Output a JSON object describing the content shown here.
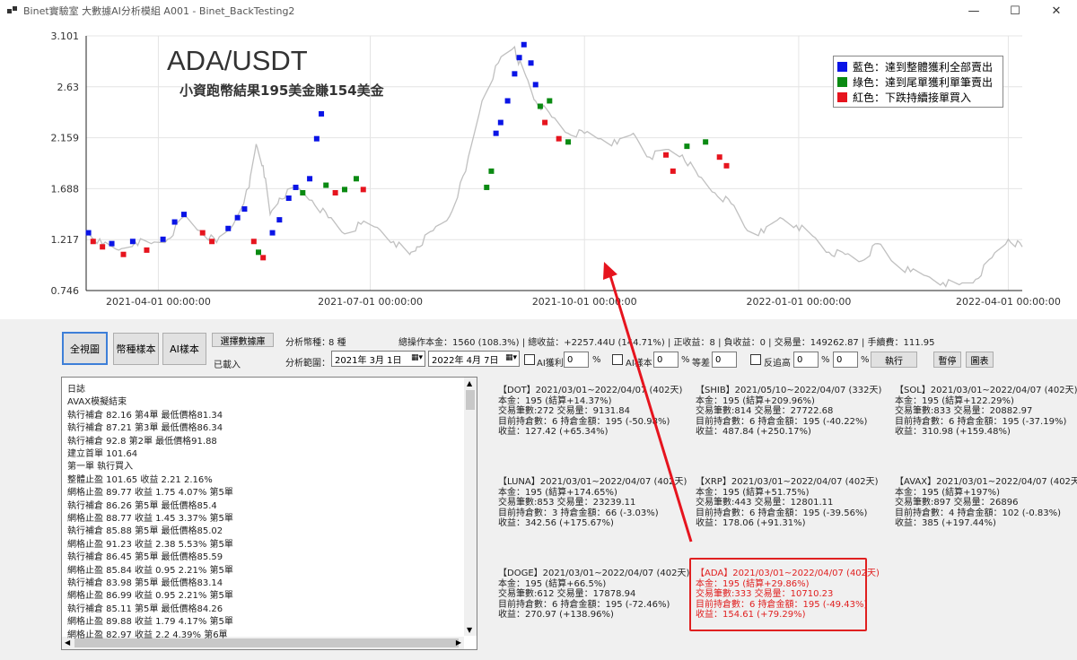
{
  "window": {
    "title": "Binet實驗室  大數據AI分析模組 A001 - Binet_BackTesting2",
    "minimize": "—",
    "maximize": "☐",
    "close": "✕"
  },
  "chart": {
    "title": "ADA/USDT",
    "subtitle": "小資跑幣結果195美金賺154美金",
    "legend": [
      {
        "label": "藍色：達到整體獲利全部賣出",
        "color": "#0a14e6"
      },
      {
        "label": "綠色：達到尾單獲利單筆賣出",
        "color": "#0a8a12"
      },
      {
        "label": "紅色：下跌持續接單買入",
        "color": "#e6141e"
      }
    ]
  },
  "chart_data": {
    "type": "line",
    "y_ticks": [
      "3.101",
      "2.63",
      "2.159",
      "1.688",
      "1.217",
      "0.746"
    ],
    "x_ticks": [
      "2021-04-01 00:00:00",
      "2021-07-01 00:00:00",
      "2021-10-01 00:00:00",
      "2022-01-01 00:00:00",
      "2022-04-01 00:00:00"
    ],
    "ylim": [
      0.746,
      3.101
    ],
    "xlim": [
      "2021-03-01",
      "2022-04-07"
    ],
    "grid": true,
    "legend_position": "top-right",
    "series": [
      {
        "color": "#c0c0c0",
        "x": [
          "2021-03-01",
          "2021-03-08",
          "2021-03-15",
          "2021-03-22",
          "2021-03-29",
          "2021-04-05",
          "2021-04-12",
          "2021-04-19",
          "2021-04-26",
          "2021-05-03",
          "2021-05-10",
          "2021-05-13",
          "2021-05-16",
          "2021-05-19",
          "2021-05-23",
          "2021-05-30",
          "2021-06-06",
          "2021-06-13",
          "2021-06-20",
          "2021-06-27",
          "2021-07-04",
          "2021-07-11",
          "2021-07-18",
          "2021-07-21",
          "2021-07-28",
          "2021-08-04",
          "2021-08-11",
          "2021-08-18",
          "2021-08-25",
          "2021-09-01",
          "2021-09-02",
          "2021-09-06",
          "2021-09-10",
          "2021-09-17",
          "2021-09-24",
          "2021-10-01",
          "2021-10-08",
          "2021-10-15",
          "2021-10-22",
          "2021-10-29",
          "2021-11-05",
          "2021-11-12",
          "2021-11-19",
          "2021-11-26",
          "2021-12-03",
          "2021-12-10",
          "2021-12-17",
          "2021-12-24",
          "2021-12-31",
          "2022-01-07",
          "2022-01-14",
          "2022-01-21",
          "2022-01-28",
          "2022-02-04",
          "2022-02-11",
          "2022-02-18",
          "2022-02-25",
          "2022-03-04",
          "2022-03-11",
          "2022-03-18",
          "2022-03-25",
          "2022-04-01",
          "2022-04-07"
        ],
        "y": [
          1.3,
          1.17,
          1.12,
          1.2,
          1.18,
          1.22,
          1.43,
          1.3,
          1.19,
          1.35,
          1.7,
          2.1,
          1.9,
          1.45,
          1.6,
          1.7,
          1.58,
          1.42,
          1.27,
          1.36,
          1.33,
          1.2,
          1.08,
          1.15,
          1.3,
          1.43,
          1.85,
          2.5,
          2.85,
          3.0,
          2.9,
          2.72,
          2.5,
          2.35,
          2.2,
          2.2,
          2.15,
          2.1,
          2.2,
          1.98,
          2.05,
          2.0,
          1.8,
          1.65,
          1.55,
          1.3,
          1.28,
          1.42,
          1.35,
          1.25,
          1.1,
          1.08,
          1.02,
          1.18,
          1.0,
          0.92,
          0.88,
          0.82,
          0.8,
          0.85,
          1.05,
          1.22,
          1.15
        ]
      }
    ],
    "markers": [
      {
        "x": "2021-03-02",
        "y": 1.28,
        "kind": "blue"
      },
      {
        "x": "2021-03-04",
        "y": 1.2,
        "kind": "red"
      },
      {
        "x": "2021-03-08",
        "y": 1.15,
        "kind": "red"
      },
      {
        "x": "2021-03-12",
        "y": 1.18,
        "kind": "blue"
      },
      {
        "x": "2021-03-17",
        "y": 1.08,
        "kind": "red"
      },
      {
        "x": "2021-03-21",
        "y": 1.2,
        "kind": "blue"
      },
      {
        "x": "2021-03-27",
        "y": 1.12,
        "kind": "red"
      },
      {
        "x": "2021-04-03",
        "y": 1.22,
        "kind": "blue"
      },
      {
        "x": "2021-04-08",
        "y": 1.38,
        "kind": "blue"
      },
      {
        "x": "2021-04-12",
        "y": 1.45,
        "kind": "blue"
      },
      {
        "x": "2021-04-20",
        "y": 1.28,
        "kind": "red"
      },
      {
        "x": "2021-04-24",
        "y": 1.2,
        "kind": "red"
      },
      {
        "x": "2021-05-01",
        "y": 1.32,
        "kind": "blue"
      },
      {
        "x": "2021-05-05",
        "y": 1.42,
        "kind": "blue"
      },
      {
        "x": "2021-05-08",
        "y": 1.5,
        "kind": "blue"
      },
      {
        "x": "2021-05-12",
        "y": 1.2,
        "kind": "red"
      },
      {
        "x": "2021-05-14",
        "y": 1.1,
        "kind": "green"
      },
      {
        "x": "2021-05-16",
        "y": 1.05,
        "kind": "red"
      },
      {
        "x": "2021-05-20",
        "y": 1.28,
        "kind": "blue"
      },
      {
        "x": "2021-05-23",
        "y": 1.4,
        "kind": "blue"
      },
      {
        "x": "2021-05-27",
        "y": 1.6,
        "kind": "blue"
      },
      {
        "x": "2021-05-30",
        "y": 1.7,
        "kind": "blue"
      },
      {
        "x": "2021-06-02",
        "y": 1.65,
        "kind": "green"
      },
      {
        "x": "2021-06-05",
        "y": 1.78,
        "kind": "blue"
      },
      {
        "x": "2021-06-08",
        "y": 2.15,
        "kind": "blue"
      },
      {
        "x": "2021-06-10",
        "y": 2.38,
        "kind": "blue"
      },
      {
        "x": "2021-06-12",
        "y": 1.72,
        "kind": "green"
      },
      {
        "x": "2021-06-16",
        "y": 1.65,
        "kind": "red"
      },
      {
        "x": "2021-06-20",
        "y": 1.68,
        "kind": "green"
      },
      {
        "x": "2021-06-25",
        "y": 1.78,
        "kind": "green"
      },
      {
        "x": "2021-06-28",
        "y": 1.68,
        "kind": "red"
      },
      {
        "x": "2021-08-20",
        "y": 1.7,
        "kind": "green"
      },
      {
        "x": "2021-08-22",
        "y": 1.85,
        "kind": "green"
      },
      {
        "x": "2021-08-24",
        "y": 2.2,
        "kind": "blue"
      },
      {
        "x": "2021-08-26",
        "y": 2.3,
        "kind": "blue"
      },
      {
        "x": "2021-08-29",
        "y": 2.5,
        "kind": "blue"
      },
      {
        "x": "2021-09-01",
        "y": 2.75,
        "kind": "blue"
      },
      {
        "x": "2021-09-03",
        "y": 2.9,
        "kind": "blue"
      },
      {
        "x": "2021-09-05",
        "y": 3.02,
        "kind": "blue"
      },
      {
        "x": "2021-09-08",
        "y": 2.85,
        "kind": "blue"
      },
      {
        "x": "2021-09-10",
        "y": 2.65,
        "kind": "blue"
      },
      {
        "x": "2021-09-12",
        "y": 2.45,
        "kind": "green"
      },
      {
        "x": "2021-09-14",
        "y": 2.3,
        "kind": "red"
      },
      {
        "x": "2021-09-16",
        "y": 2.5,
        "kind": "green"
      },
      {
        "x": "2021-09-20",
        "y": 2.15,
        "kind": "red"
      },
      {
        "x": "2021-09-24",
        "y": 2.12,
        "kind": "green"
      },
      {
        "x": "2021-11-05",
        "y": 2.0,
        "kind": "red"
      },
      {
        "x": "2021-11-08",
        "y": 1.85,
        "kind": "red"
      },
      {
        "x": "2021-11-14",
        "y": 2.08,
        "kind": "green"
      },
      {
        "x": "2021-11-22",
        "y": 2.12,
        "kind": "green"
      },
      {
        "x": "2021-11-28",
        "y": 1.98,
        "kind": "red"
      },
      {
        "x": "2021-12-01",
        "y": 1.9,
        "kind": "red"
      }
    ]
  },
  "controls": {
    "btn_fullview": "全視圖",
    "btn_coinsample": "幣種樣本",
    "btn_aisample": "AI樣本",
    "btn_selectdata": "選擇數據庫",
    "loaded": "已載入",
    "analysis_coins_label": "分析幣種：",
    "analysis_coins_value": "8 種",
    "analysis_range_label": "分析範圍：",
    "date_start": "2021年  3月  1日",
    "date_end": "2022年  4月  7日",
    "chk_ai_profit": "AI獲利",
    "chk_ai_sample": "AI樣本",
    "pct": "%",
    "diff_label": "等差",
    "chk_reverse": "反追高",
    "ai_profit_value": "0",
    "ai_sample_value": "0",
    "diff_value": "0",
    "rev_value1": "0",
    "rev_value2": "0",
    "btn_execute": "執行",
    "btn_pause": "暫停",
    "btn_chart": "圖表",
    "summary": "總操作本金：1560 (108.3%) | 總收益：+2257.44U (144.71%) | 正收益：8 | 負收益：0 | 交易量：149262.87 | 手續費：111.95"
  },
  "log": {
    "lines": [
      "日誌",
      "AVAX模擬結束",
      "執行補倉 82.16 第4單 最低價格81.34",
      "執行補倉 87.21 第3單 最低價格86.34",
      "執行補倉 92.8 第2單 最低價格91.88",
      "建立首單 101.64",
      "第一單 執行買入",
      "整體止盈 101.65 收益 2.21  2.16%",
      "網格止盈 89.77 收益 1.75 4.07% 第5單",
      "執行補倉 86.26 第5單 最低價格85.4",
      "網格止盈 88.77 收益 1.45 3.37% 第5單",
      "執行補倉 85.88 第5單 最低價格85.02",
      "網格止盈 91.23 收益 2.38 5.53% 第5單",
      "執行補倉 86.45 第5單 最低價格85.59",
      "網格止盈 85.84 收益 0.95 2.21% 第5單",
      "執行補倉 83.98 第5單 最低價格83.14",
      "網格止盈 86.99 收益 0.95 2.21% 第5單",
      "執行補倉 85.11 第5單 最低價格84.26",
      "網格止盈 89.88 收益 1.79 4.17% 第5單",
      "網格止盈 82.97 收益 2.2 4.39% 第6單"
    ]
  },
  "coins": [
    {
      "l1": "【DOT】2021/03/01~2022/04/07 (402天)",
      "l2": "本金：195  (結算+14.37%)",
      "l3": "交易筆數:272   交易量：9131.84",
      "l4": "目前持倉數：6  持倉金額：195 (-50.98%)",
      "l5": "收益：127.42 (+65.34%)"
    },
    {
      "l1": "【SHIB】2021/05/10~2022/04/07 (332天)",
      "l2": "本金：195  (結算+209.96%)",
      "l3": "交易筆數:814   交易量：27722.68",
      "l4": "目前持倉數：6  持倉金額：195 (-40.22%)",
      "l5": "收益：487.84 (+250.17%)"
    },
    {
      "l1": "【SOL】2021/03/01~2022/04/07 (402天)",
      "l2": "本金：195  (結算+122.29%)",
      "l3": "交易筆數:833   交易量：20882.97",
      "l4": "目前持倉數：6  持倉金額：195 (-37.19%)",
      "l5": "收益：310.98 (+159.48%)"
    },
    {
      "l1": "【LUNA】2021/03/01~2022/04/07 (402天)",
      "l2": "本金：195  (結算+174.65%)",
      "l3": "交易筆數:853   交易量：23239.11",
      "l4": "目前持倉數：3  持倉金額：66 (-3.03%)",
      "l5": "收益：342.56 (+175.67%)"
    },
    {
      "l1": "【XRP】2021/03/01~2022/04/07 (402天)",
      "l2": "本金：195  (結算+51.75%)",
      "l3": "交易筆數:443   交易量：12801.11",
      "l4": "目前持倉數：6  持倉金額：195 (-39.56%)",
      "l5": "收益：178.06 (+91.31%)"
    },
    {
      "l1": "【AVAX】2021/03/01~2022/04/07 (402天)",
      "l2": "本金：195  (結算+197%)",
      "l3": "交易筆數:897   交易量：26896",
      "l4": "目前持倉數：4  持倉金額：102 (-0.83%)",
      "l5": "收益：385 (+197.44%)"
    },
    {
      "l1": "【DOGE】2021/03/01~2022/04/07 (402天)",
      "l2": "本金：195  (結算+66.5%)",
      "l3": "交易筆數:612   交易量：17878.94",
      "l4": "目前持倉數：6  持倉金額：195 (-72.46%)",
      "l5": "收益：270.97 (+138.96%)"
    },
    {
      "l1": "【ADA】2021/03/01~2022/04/07 (402天)",
      "l2": "本金：195  (結算+29.86%)",
      "l3": "交易筆數:333   交易量：10710.23",
      "l4": "目前持倉數：6  持倉金額：195 (-49.43%)",
      "l5": "收益：154.61 (+79.29%)"
    }
  ]
}
